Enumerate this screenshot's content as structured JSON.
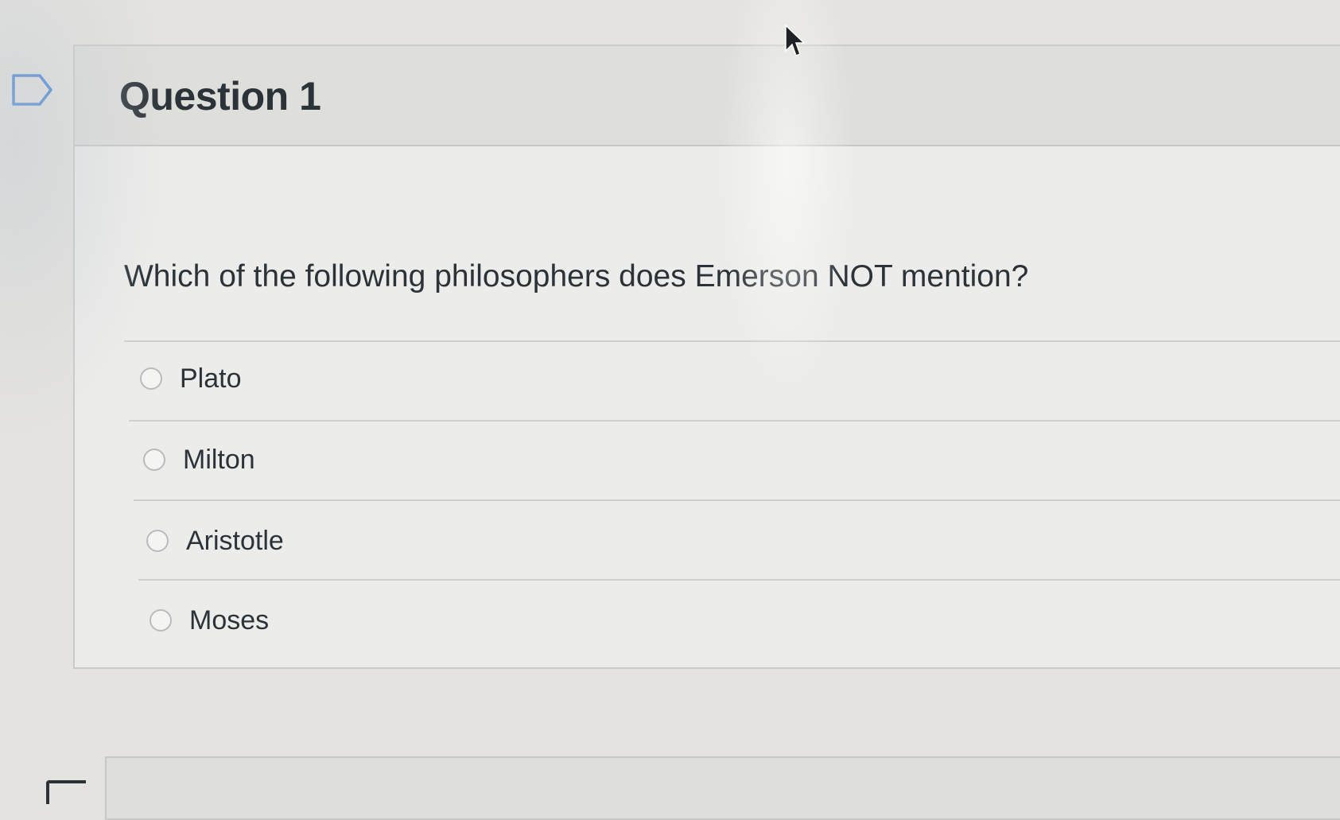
{
  "question": {
    "title": "Question 1",
    "text": "Which of the following philosophers does Emerson NOT mention?",
    "answers": [
      {
        "label": "Plato",
        "selected": false
      },
      {
        "label": "Milton",
        "selected": false
      },
      {
        "label": "Aristotle",
        "selected": false
      },
      {
        "label": "Moses",
        "selected": false
      }
    ]
  },
  "icons": {
    "bookmark": "bookmark-flag-icon",
    "cursor": "mouse-pointer-icon",
    "radio": "radio-button-icon"
  },
  "colors": {
    "page_background": "#e4e3df",
    "header_background": "#dededb",
    "text": "#2b3338",
    "divider": "#cfd1cf"
  }
}
